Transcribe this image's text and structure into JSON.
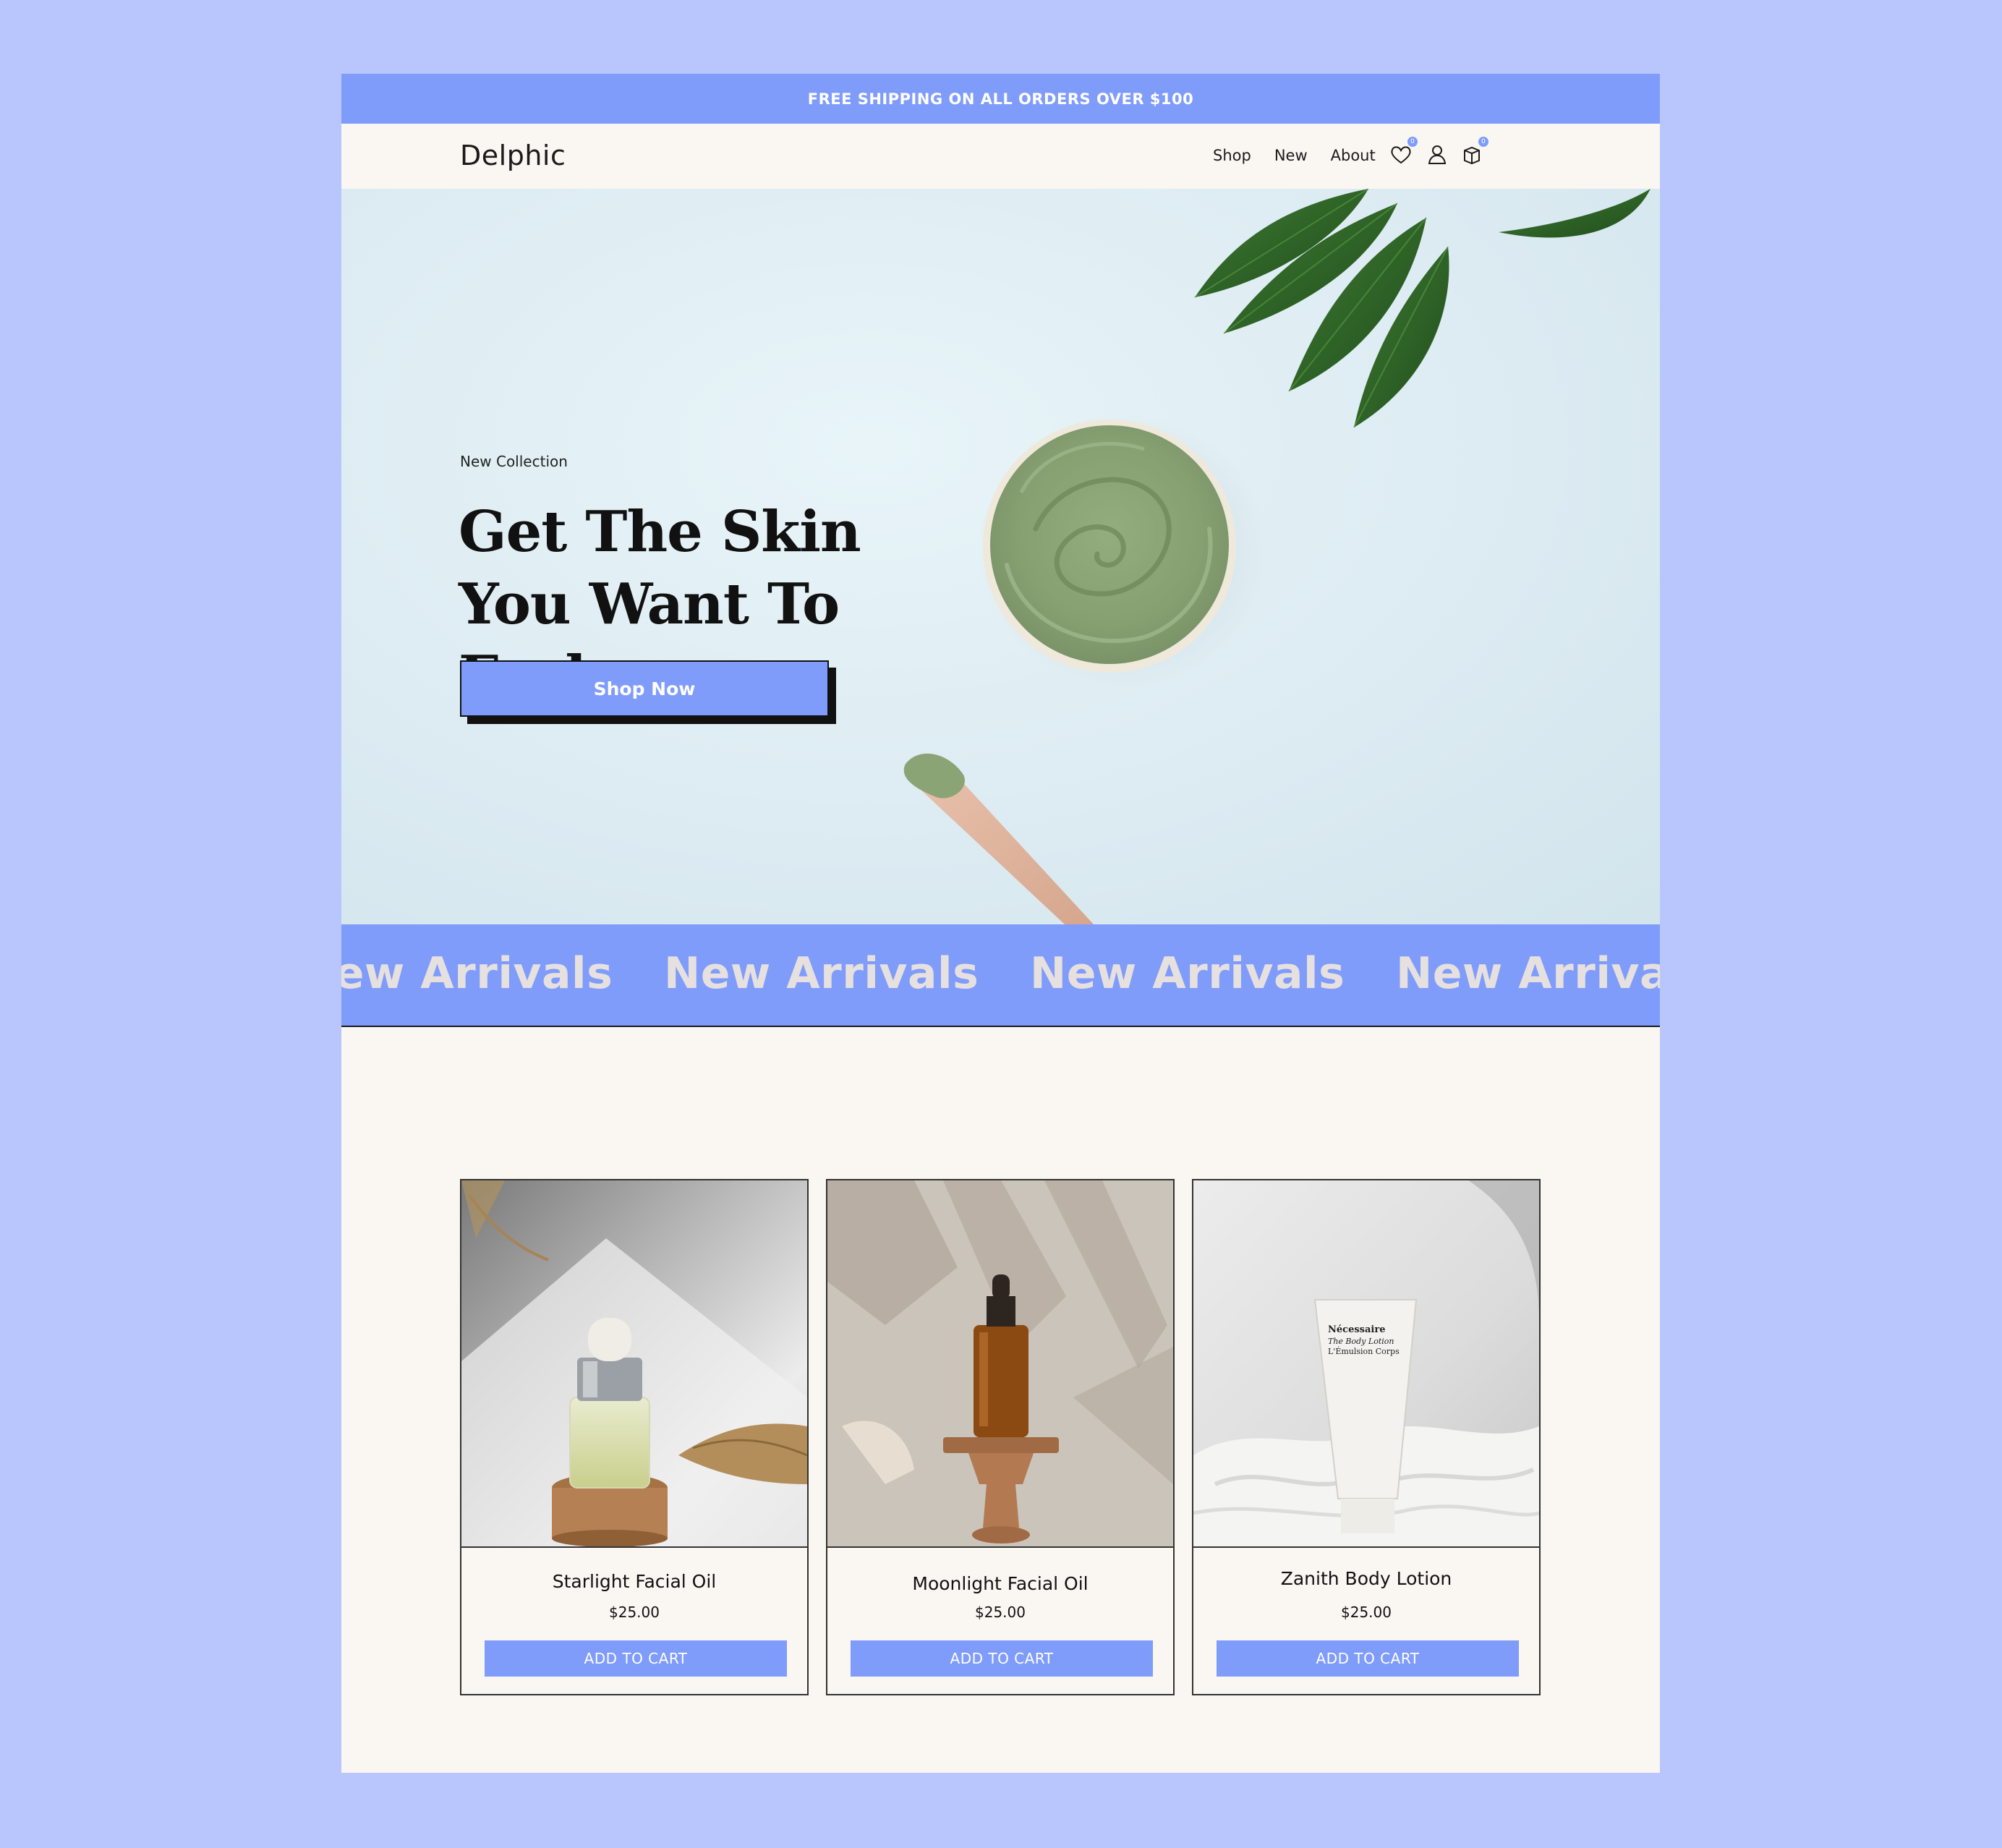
{
  "announcement": {
    "text": "FREE SHIPPING ON ALL ORDERS OVER $100"
  },
  "brand": {
    "name": "Delphic",
    "accent": "#7f9cfb",
    "background": "#b9c6fd",
    "surface": "#faf6f1"
  },
  "nav": {
    "items": [
      {
        "label": "Shop"
      },
      {
        "label": "New"
      },
      {
        "label": "About"
      }
    ],
    "icons": [
      "heart-icon",
      "user-icon",
      "cart-icon"
    ],
    "wishlist_count": "0",
    "cart_count": "0"
  },
  "hero": {
    "eyebrow": "New Collection",
    "headline": "Get The Skin You Want To Feel",
    "cta_label": "Shop Now"
  },
  "marquee": {
    "items": [
      "New Arrivals",
      "New Arrivals",
      "New Arrivals",
      "New Arrivals"
    ]
  },
  "products": [
    {
      "name": "Starlight Facial Oil",
      "price": "$25.00",
      "button": "ADD TO CART"
    },
    {
      "name": "Moonlight Facial Oil",
      "price": "$25.00",
      "button": "ADD TO CART"
    },
    {
      "name": "Zanith Body Lotion",
      "price": "$25.00",
      "button": "ADD TO CART"
    }
  ],
  "product_image_text": {
    "lotion_brand": "Nécessaire",
    "lotion_line1": "The Body Lotion",
    "lotion_line2": "L'Émulsion Corps"
  }
}
